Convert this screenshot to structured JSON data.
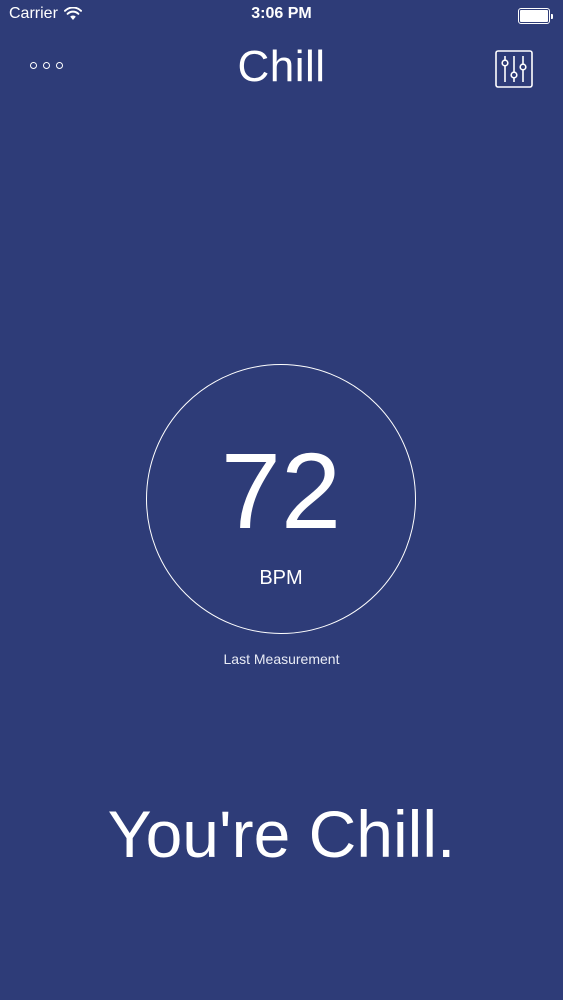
{
  "status_bar": {
    "carrier": "Carrier",
    "time": "3:06 PM",
    "battery_level": 1.0
  },
  "nav": {
    "title": "Chill",
    "more_icon": "more-dots-icon",
    "settings_icon": "sliders-icon"
  },
  "measurement": {
    "value": "72",
    "unit": "BPM",
    "caption": "Last Measurement"
  },
  "message": "You're Chill.",
  "colors": {
    "background": "#2e3c78",
    "foreground": "#ffffff"
  }
}
